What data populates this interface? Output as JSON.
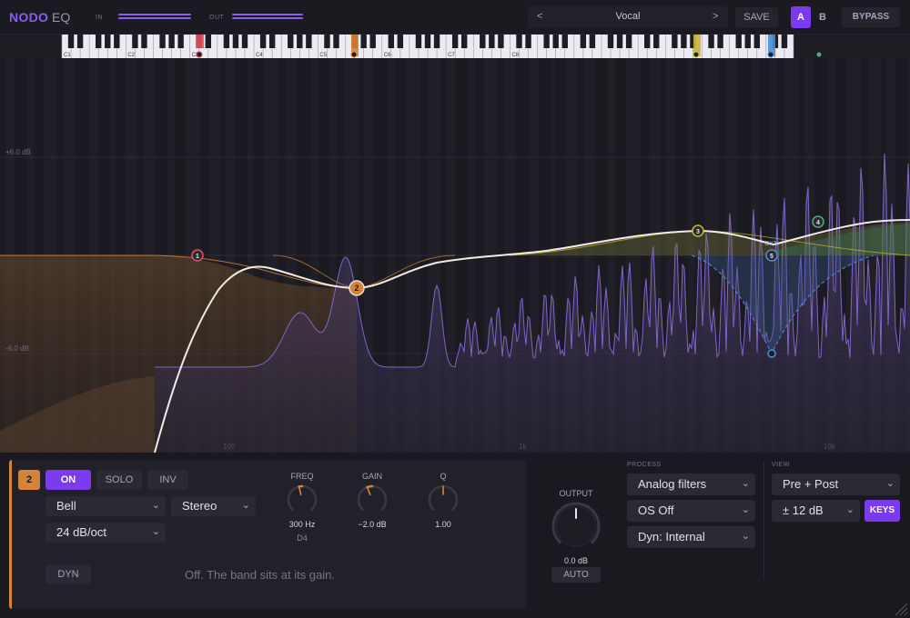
{
  "app": {
    "brand": "NODO",
    "brand_suffix": "EQ"
  },
  "meters": {
    "in_label": "IN",
    "out_label": "OUT"
  },
  "preset": {
    "prev": "<",
    "name": "Vocal",
    "next": ">",
    "save": "SAVE"
  },
  "ab": {
    "a": "A",
    "b": "B",
    "active": "A"
  },
  "bypass": "BYPASS",
  "piano": {
    "octave_labels": [
      "C1",
      "C2",
      "C3",
      "C4",
      "C5",
      "C6",
      "C7",
      "C8"
    ]
  },
  "graph": {
    "db_labels": [
      "+6.0 dB",
      "-6.0 dB"
    ],
    "freq_labels": [
      "100",
      "1k",
      "10k"
    ],
    "dyn_tag": "DYN",
    "bands": [
      {
        "id": "1",
        "color": "#e0525a"
      },
      {
        "id": "2",
        "color": "#d4843a"
      },
      {
        "id": "3",
        "color": "#c9b63a"
      },
      {
        "id": "4",
        "color": "#4fae7a"
      },
      {
        "id": "5",
        "color": "#4a8fd6"
      }
    ]
  },
  "band_panel": {
    "band_number": "2",
    "on": "ON",
    "solo": "SOLO",
    "inv": "INV",
    "shape": "Bell",
    "channel": "Stereo",
    "slope": "24 dB/oct",
    "dyn": "DYN",
    "dyn_status": "Off. The band sits at its gain.",
    "freq": {
      "label": "FREQ",
      "value": "300 Hz",
      "note": "D4",
      "level": 0.45
    },
    "gain": {
      "label": "GAIN",
      "value": "−2.0 dB",
      "level": 0.42
    },
    "q": {
      "label": "Q",
      "value": "1.00",
      "level": 0.5
    }
  },
  "output": {
    "label": "OUTPUT",
    "value": "0.0 dB",
    "auto": "AUTO",
    "level": 0.5
  },
  "process": {
    "label": "PROCESS",
    "filter": "Analog filters",
    "os": "OS Off",
    "dyn": "Dyn: Internal"
  },
  "view": {
    "label": "VIEW",
    "mode": "Pre + Post",
    "range": "± 12 dB",
    "keys": "KEYS"
  },
  "colors": {
    "accent": "#7c3aed",
    "band2": "#d4843a"
  }
}
